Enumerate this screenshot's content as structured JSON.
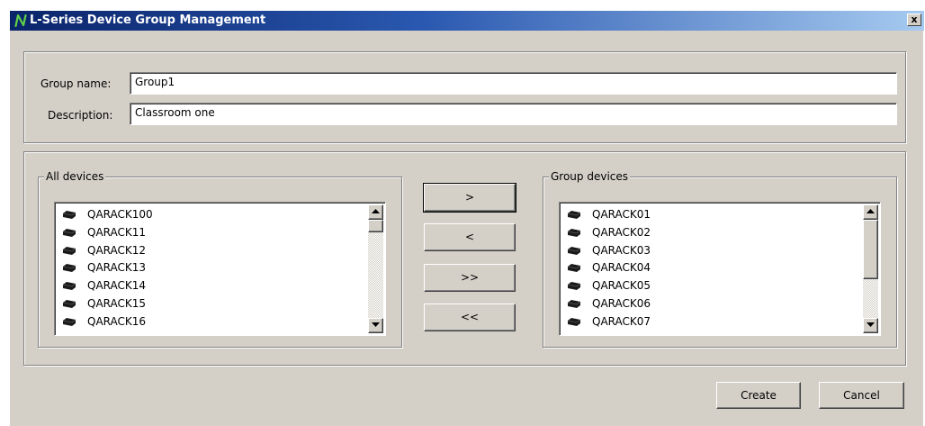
{
  "window": {
    "title": "L-Series Device Group Management",
    "close_label": "x",
    "logo": "n-logo-icon",
    "colors": {
      "titlebar_start": "#0a246a",
      "titlebar_end": "#a6caf0",
      "face": "#d4d0c8",
      "logo": "#5fd048"
    }
  },
  "form": {
    "group_name_label": "Group name:",
    "group_name_value": "Group1",
    "description_label": "Description:",
    "description_value": "Classroom one"
  },
  "all_devices": {
    "legend": "All devices",
    "items": [
      "QARACK100",
      "QARACK11",
      "QARACK12",
      "QARACK13",
      "QARACK14",
      "QARACK15",
      "QARACK16"
    ]
  },
  "transfer": {
    "add_label": ">",
    "remove_label": "<",
    "add_all_label": ">>",
    "remove_all_label": "<<"
  },
  "group_devices": {
    "legend": "Group devices",
    "items": [
      "QARACK01",
      "QARACK02",
      "QARACK03",
      "QARACK04",
      "QARACK05",
      "QARACK06",
      "QARACK07"
    ]
  },
  "footer": {
    "create_label": "Create",
    "cancel_label": "Cancel"
  }
}
